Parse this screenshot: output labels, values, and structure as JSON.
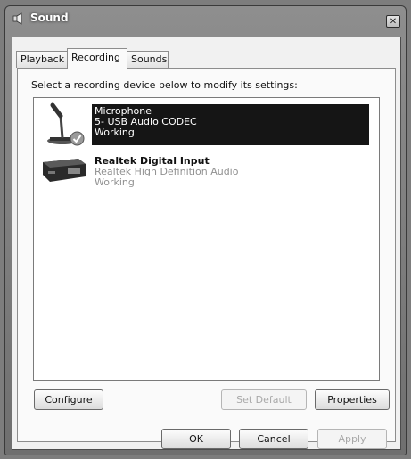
{
  "window": {
    "title": "Sound",
    "close_glyph": "✕"
  },
  "tabs": [
    {
      "label": "Playback",
      "active": false
    },
    {
      "label": "Recording",
      "active": true
    },
    {
      "label": "Sounds",
      "active": false
    }
  ],
  "instruction": "Select a recording device below to modify its settings:",
  "devices": [
    {
      "name": "Microphone",
      "description": "5- USB Audio CODEC",
      "status": "Working",
      "selected": true,
      "icon": "microphone-icon",
      "default_badge": "check-icon"
    },
    {
      "name": "Realtek Digital Input",
      "description": "Realtek High Definition Audio",
      "status": "Working",
      "selected": false,
      "icon": "digital-input-icon"
    }
  ],
  "panel_buttons": {
    "configure": "Configure",
    "set_default": "Set Default",
    "properties": "Properties"
  },
  "dialog_buttons": {
    "ok": "OK",
    "cancel": "Cancel",
    "apply": "Apply"
  },
  "colors": {
    "selection": "#151515",
    "dialog_bg": "#f1f1f1",
    "frame": "#7d7d7d"
  }
}
